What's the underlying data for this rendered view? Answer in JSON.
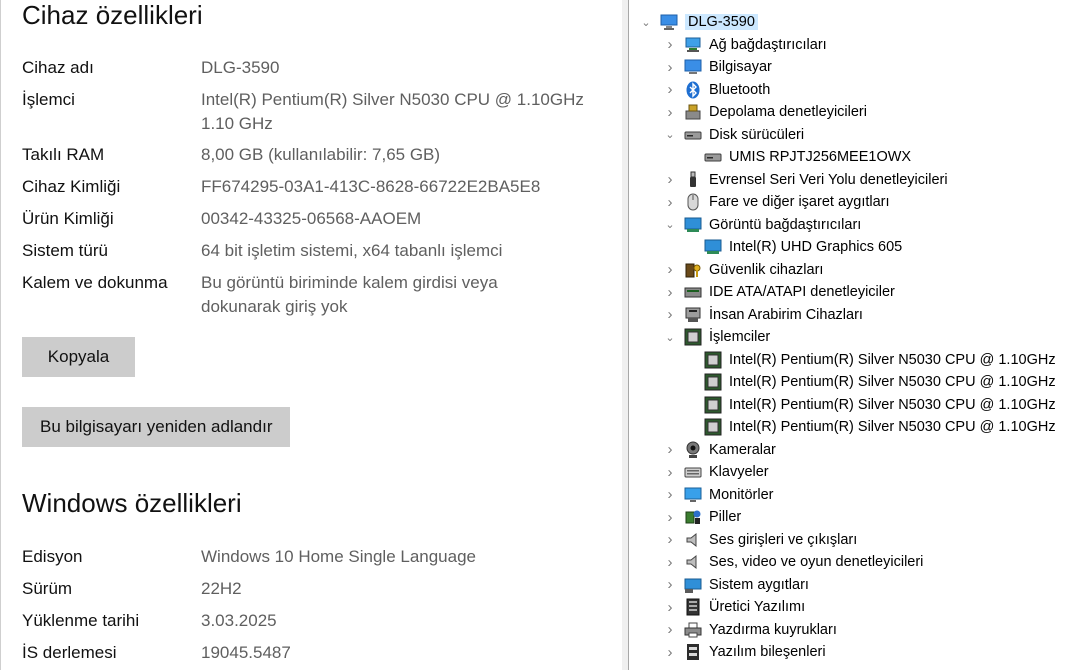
{
  "device_specs": {
    "title": "Cihaz özellikleri",
    "rows": [
      {
        "label": "Cihaz adı",
        "value": "DLG-3590"
      },
      {
        "label": "İşlemci",
        "value": "Intel(R) Pentium(R) Silver N5030 CPU @ 1.10GHz",
        "value2": "1.10 GHz"
      },
      {
        "label": "Takılı RAM",
        "value": "8,00 GB (kullanılabilir: 7,65 GB)"
      },
      {
        "label": "Cihaz Kimliği",
        "value": "FF674295-03A1-413C-8628-66722E2BA5E8"
      },
      {
        "label": "Ürün Kimliği",
        "value": "00342-43325-06568-AAOEM"
      },
      {
        "label": "Sistem türü",
        "value": "64 bit işletim sistemi, x64 tabanlı işlemci"
      },
      {
        "label": "Kalem ve dokunma",
        "value": "Bu görüntü biriminde kalem girdisi veya",
        "value2": "dokunarak giriş yok"
      }
    ],
    "copy_button": "Kopyala",
    "rename_button": "Bu bilgisayarı yeniden adlandır"
  },
  "windows_specs": {
    "title": "Windows özellikleri",
    "rows": [
      {
        "label": "Edisyon",
        "value": "Windows 10 Home Single Language"
      },
      {
        "label": "Sürüm",
        "value": "22H2"
      },
      {
        "label": "Yüklenme tarihi",
        "value": "3.03.2025"
      },
      {
        "label": "İS derlemesi",
        "value": "19045.5487"
      }
    ]
  },
  "device_manager": {
    "root": "DLG-3590",
    "nodes": [
      {
        "label": "Ağ bağdaştırıcıları",
        "icon": "network-adapter-icon",
        "level": 1,
        "state": "collapsed"
      },
      {
        "label": "Bilgisayar",
        "icon": "computer-icon",
        "level": 1,
        "state": "collapsed"
      },
      {
        "label": "Bluetooth",
        "icon": "bluetooth-icon",
        "level": 1,
        "state": "collapsed"
      },
      {
        "label": "Depolama denetleyicileri",
        "icon": "storage-controller-icon",
        "level": 1,
        "state": "collapsed"
      },
      {
        "label": "Disk sürücüleri",
        "icon": "disk-drive-icon",
        "level": 1,
        "state": "expanded"
      },
      {
        "label": "UMIS RPJTJ256MEE1OWX",
        "icon": "disk-drive-icon",
        "level": 2,
        "state": "leaf"
      },
      {
        "label": "Evrensel Seri Veri Yolu denetleyicileri",
        "icon": "usb-icon",
        "level": 1,
        "state": "collapsed"
      },
      {
        "label": "Fare ve diğer işaret aygıtları",
        "icon": "mouse-icon",
        "level": 1,
        "state": "collapsed"
      },
      {
        "label": "Görüntü bağdaştırıcıları",
        "icon": "display-adapter-icon",
        "level": 1,
        "state": "expanded"
      },
      {
        "label": "Intel(R) UHD Graphics 605",
        "icon": "display-adapter-icon",
        "level": 2,
        "state": "leaf"
      },
      {
        "label": "Güvenlik cihazları",
        "icon": "security-device-icon",
        "level": 1,
        "state": "collapsed"
      },
      {
        "label": "IDE ATA/ATAPI denetleyiciler",
        "icon": "ide-controller-icon",
        "level": 1,
        "state": "collapsed"
      },
      {
        "label": "İnsan Arabirim Cihazları",
        "icon": "hid-icon",
        "level": 1,
        "state": "collapsed"
      },
      {
        "label": "İşlemciler",
        "icon": "processor-icon",
        "level": 1,
        "state": "expanded"
      },
      {
        "label": "Intel(R) Pentium(R) Silver N5030 CPU @ 1.10GHz",
        "icon": "processor-icon",
        "level": 2,
        "state": "leaf"
      },
      {
        "label": "Intel(R) Pentium(R) Silver N5030 CPU @ 1.10GHz",
        "icon": "processor-icon",
        "level": 2,
        "state": "leaf"
      },
      {
        "label": "Intel(R) Pentium(R) Silver N5030 CPU @ 1.10GHz",
        "icon": "processor-icon",
        "level": 2,
        "state": "leaf"
      },
      {
        "label": "Intel(R) Pentium(R) Silver N5030 CPU @ 1.10GHz",
        "icon": "processor-icon",
        "level": 2,
        "state": "leaf"
      },
      {
        "label": "Kameralar",
        "icon": "camera-icon",
        "level": 1,
        "state": "collapsed"
      },
      {
        "label": "Klavyeler",
        "icon": "keyboard-icon",
        "level": 1,
        "state": "collapsed"
      },
      {
        "label": "Monitörler",
        "icon": "monitor-icon",
        "level": 1,
        "state": "collapsed"
      },
      {
        "label": "Piller",
        "icon": "battery-icon",
        "level": 1,
        "state": "collapsed"
      },
      {
        "label": "Ses girişleri ve çıkışları",
        "icon": "speaker-icon",
        "level": 1,
        "state": "collapsed"
      },
      {
        "label": "Ses, video ve oyun denetleyicileri",
        "icon": "speaker-icon",
        "level": 1,
        "state": "collapsed"
      },
      {
        "label": "Sistem aygıtları",
        "icon": "system-device-icon",
        "level": 1,
        "state": "collapsed"
      },
      {
        "label": "Üretici Yazılımı",
        "icon": "firmware-icon",
        "level": 1,
        "state": "collapsed"
      },
      {
        "label": "Yazdırma kuyrukları",
        "icon": "printer-icon",
        "level": 1,
        "state": "collapsed"
      },
      {
        "label": "Yazılım bileşenleri",
        "icon": "software-component-icon",
        "level": 1,
        "state": "collapsed"
      }
    ]
  }
}
